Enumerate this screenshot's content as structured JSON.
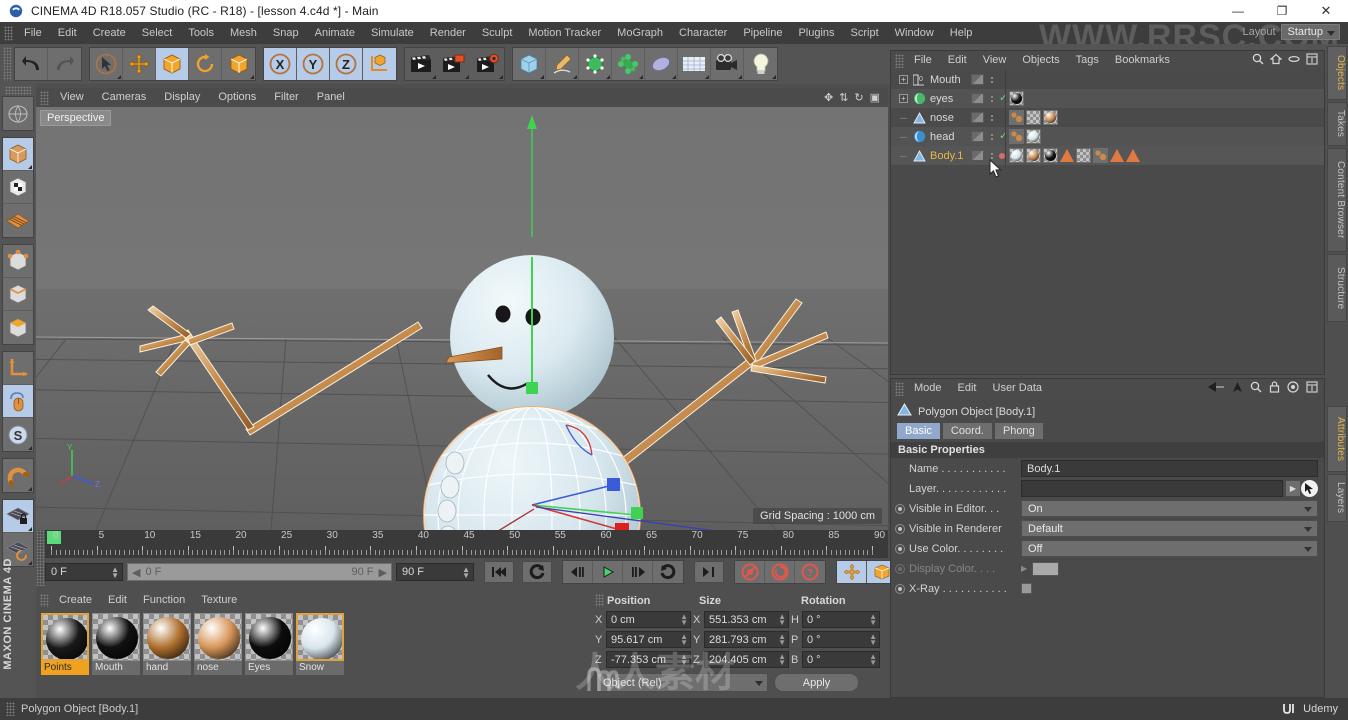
{
  "titlebar": {
    "title": "CINEMA 4D R18.057 Studio (RC - R18) - [lesson 4.c4d *] - Main",
    "minimize": "—",
    "maximize": "❐",
    "close": "✕"
  },
  "menubar": {
    "items": [
      "File",
      "Edit",
      "Create",
      "Select",
      "Tools",
      "Mesh",
      "Snap",
      "Animate",
      "Simulate",
      "Render",
      "Sculpt",
      "Motion Tracker",
      "MoGraph",
      "Character",
      "Pipeline",
      "Plugins",
      "Script",
      "Window",
      "Help"
    ],
    "layout_label": "Layout",
    "layout_value": "Startup"
  },
  "viewport": {
    "menu": [
      "View",
      "Cameras",
      "Display",
      "Options",
      "Filter",
      "Panel"
    ],
    "perspective_tag": "Perspective",
    "grid_spacing": "Grid Spacing : 1000 cm"
  },
  "timeline": {
    "ticks": [
      0,
      5,
      10,
      15,
      20,
      25,
      30,
      35,
      40,
      45,
      50,
      55,
      60,
      65,
      70,
      75,
      80,
      85,
      90
    ],
    "current_frame": "0 F",
    "range_start": "0 F",
    "range_end": "90 F",
    "end_frame": "90 F",
    "frame_field_right": "0 F"
  },
  "materials": {
    "menu": [
      "Create",
      "Edit",
      "Function",
      "Texture"
    ],
    "items": [
      {
        "name": "Points",
        "color": "#1a1a1a",
        "selected": true
      },
      {
        "name": "Mouth",
        "color": "#111111",
        "selected": false
      },
      {
        "name": "hand",
        "color": "#b0712f",
        "selected": false
      },
      {
        "name": "nose",
        "color": "#d8975a",
        "selected": false
      },
      {
        "name": "Eyes",
        "color": "#0d0d0d",
        "selected": false
      },
      {
        "name": "Snow",
        "color": "#d7e6ec",
        "selected": true
      }
    ]
  },
  "coordinates": {
    "headers": [
      "Position",
      "Size",
      "Rotation"
    ],
    "rows": [
      {
        "axis": "X",
        "position": "0 cm",
        "size_axis": "X",
        "size": "551.353 cm",
        "rot_axis": "H",
        "rotation": "0 °"
      },
      {
        "axis": "Y",
        "position": "95.617 cm",
        "size_axis": "Y",
        "size": "281.793 cm",
        "rot_axis": "P",
        "rotation": "0 °"
      },
      {
        "axis": "Z",
        "position": "-77.353 cm",
        "size_axis": "Z",
        "size": "204.405 cm",
        "rot_axis": "B",
        "rotation": "0 °"
      }
    ],
    "mode": "Object (Rel)",
    "apply": "Apply"
  },
  "object_manager": {
    "menu": [
      "File",
      "Edit",
      "View",
      "Objects",
      "Tags",
      "Bookmarks"
    ],
    "objects": [
      {
        "name": "Mouth",
        "icon": "spline-icon",
        "expandable": true,
        "check": false,
        "tags": []
      },
      {
        "name": "eyes",
        "icon": "sphere-icon",
        "expandable": true,
        "check": true,
        "tags": [
          {
            "type": "material",
            "color": "#111111"
          }
        ]
      },
      {
        "name": "nose",
        "icon": "polygon-icon",
        "expandable": false,
        "check": false,
        "tags": [
          {
            "type": "point",
            "color": "#c98a4b"
          },
          {
            "type": "checker",
            "color": ""
          },
          {
            "type": "material",
            "color": "#c48a52"
          }
        ]
      },
      {
        "name": "head",
        "icon": "sphere-icon",
        "expandable": false,
        "check": true,
        "tags": [
          {
            "type": "point",
            "color": "#c98a4b"
          },
          {
            "type": "material",
            "color": "#d7e6ec"
          }
        ]
      },
      {
        "name": "Body.1",
        "icon": "polygon-icon",
        "expandable": false,
        "check": false,
        "selected": true,
        "tags": [
          {
            "type": "material",
            "color": "#d7e6ec"
          },
          {
            "type": "material",
            "color": "#c48a52"
          },
          {
            "type": "material",
            "color": "#111111"
          },
          {
            "type": "triangle",
            "color": "#e07a42"
          },
          {
            "type": "checker",
            "color": ""
          },
          {
            "type": "point",
            "color": "#c98a4b"
          },
          {
            "type": "triangle",
            "color": "#e07a42"
          },
          {
            "type": "triangle",
            "color": "#e07a42"
          }
        ]
      }
    ]
  },
  "attributes": {
    "menu": [
      "Mode",
      "Edit",
      "User Data"
    ],
    "object_title": "Polygon Object [Body.1]",
    "tabs": [
      {
        "label": "Basic",
        "selected": true
      },
      {
        "label": "Coord.",
        "selected": false
      },
      {
        "label": "Phong",
        "selected": false
      }
    ],
    "section": "Basic Properties",
    "fields": [
      {
        "label": "Name . . . . . . . . . . .",
        "type": "text",
        "value": "Body.1"
      },
      {
        "label": "Layer. . . . . . . . . . . .",
        "type": "layer",
        "value": ""
      },
      {
        "label": "Visible in Editor. . .",
        "type": "dropdown",
        "value": "On"
      },
      {
        "label": "Visible in Renderer",
        "type": "dropdown",
        "value": "Default"
      },
      {
        "label": "Use Color. . . . . . . .",
        "type": "dropdown",
        "value": "Off"
      },
      {
        "label": "Display Color. . . .",
        "type": "swatch",
        "value": "",
        "dimmed": true
      },
      {
        "label": "X-Ray . . . . . . . . . . .",
        "type": "checkbox",
        "value": ""
      }
    ]
  },
  "right_tabs": [
    {
      "label": "Objects",
      "active": true
    },
    {
      "label": "Takes",
      "active": false
    },
    {
      "label": "Content Browser",
      "active": false
    },
    {
      "label": "Structure",
      "active": false
    },
    {
      "label": "Attributes",
      "active": true
    },
    {
      "label": "Layers",
      "active": false
    }
  ],
  "statusbar": {
    "text": "Polygon Object [Body.1]",
    "brand": "Udemy"
  },
  "branding": {
    "left_vertical": "MAXON\nCINEMA 4D"
  },
  "watermarks": {
    "top": "WWW.RRSC.COM",
    "middle": "人人素材"
  }
}
